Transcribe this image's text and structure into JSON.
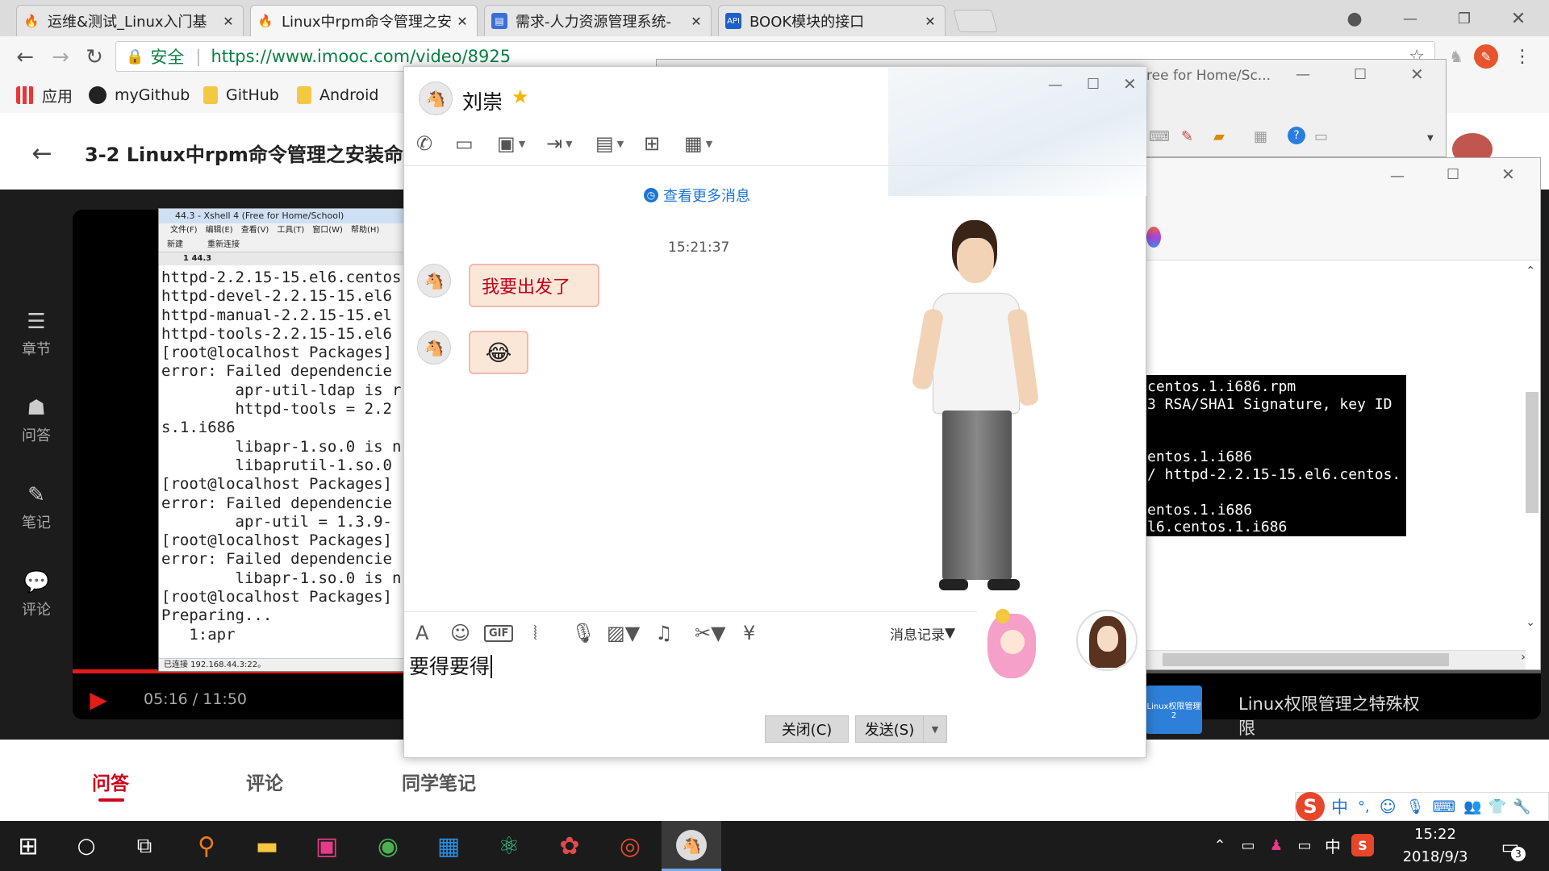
{
  "browser": {
    "tabs": [
      {
        "label": "运维&测试_Linux入门基",
        "icon": "flame-icon"
      },
      {
        "label": "Linux中rpm命令管理之安",
        "icon": "flame-icon"
      },
      {
        "label": "需求-人力资源管理系统-",
        "icon": "doc-icon"
      },
      {
        "label": "BOOK模块的接口",
        "icon": "api-icon"
      }
    ],
    "active_tab": 1,
    "secure_label": "安全",
    "url": "https://www.imooc.com/video/8925",
    "bookmarks": [
      {
        "label": "应用"
      },
      {
        "label": "myGithub"
      },
      {
        "label": "GitHub"
      },
      {
        "label": "Android"
      }
    ]
  },
  "page": {
    "title": "3-2 Linux中rpm命令管理之安装命令",
    "sidebar": [
      "章节",
      "问答",
      "笔记",
      "评论"
    ],
    "player_time": "05:16 / 11:50",
    "bottom_tabs": [
      "问答",
      "评论",
      "同学笔记"
    ],
    "active_bottom_tab": "问答",
    "next_video_title": "Linux权限管理之特殊权限",
    "next_video_thumb_label": "Linux权限管理2"
  },
  "xshell": {
    "title": "44.3 - Xshell 4 (Free for Home/School)",
    "menu": [
      "文件(F)",
      "编辑(E)",
      "查看(V)",
      "工具(T)",
      "窗口(W)",
      "帮助(H)"
    ],
    "toolbar": [
      "新建",
      "重新连接"
    ],
    "session_tab": "1 44.3",
    "lines": [
      "httpd-2.2.15-15.el6.centos",
      "httpd-devel-2.2.15-15.el6",
      "httpd-manual-2.2.15-15.el",
      "httpd-tools-2.2.15-15.el6",
      "[root@localhost Packages]",
      "error: Failed dependencie",
      "        apr-util-ldap is r",
      "        httpd-tools = 2.2",
      "s.1.i686",
      "        libapr-1.so.0 is n",
      "        libaprutil-1.so.0",
      "[root@localhost Packages]",
      "error: Failed dependencie",
      "        apr-util = 1.3.9-",
      "[root@localhost Packages]",
      "error: Failed dependencie",
      "        libapr-1.so.0 is n",
      "[root@localhost Packages]",
      "Preparing...",
      "   1:apr"
    ],
    "status": "已连接 192.168.44.3:22。"
  },
  "bg_window": {
    "title_fragment": "ree for Home/Sc...",
    "terminal_lines": [
      "centos.1.i686.rpm",
      "3 RSA/SHA1 Signature, key ID",
      "",
      "",
      "entos.1.i686",
      "/ httpd-2.2.15-15.el6.centos.",
      "",
      "entos.1.i686",
      "l6.centos.1.i686"
    ]
  },
  "chat": {
    "contact_name": "刘崇",
    "more_messages": "查看更多消息",
    "timestamp": "15:21:37",
    "messages": [
      {
        "type": "text",
        "text": "我要出发了"
      },
      {
        "type": "emoji",
        "text": "😂"
      }
    ],
    "history_label": "消息记录",
    "input_text": "要得要得",
    "close_button": "关闭(C)",
    "send_button": "发送(S)",
    "gif_label": "GIF"
  },
  "taskbar": {
    "time": "15:22",
    "date": "2018/9/3",
    "ime_lang": "中",
    "notification_count": "3"
  },
  "colors": {
    "accent_red": "#d0021b",
    "bubble_bg": "#fbe7d8",
    "link_blue": "#1e74d2",
    "taskbar": "#1b1b1b"
  }
}
